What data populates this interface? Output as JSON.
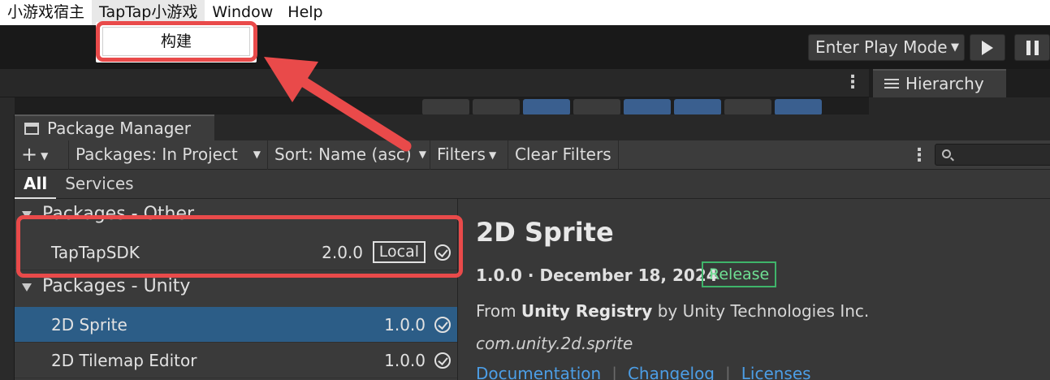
{
  "menubar": {
    "items": [
      "小游戏宿主",
      "TapTap小游戏",
      "Window",
      "Help"
    ]
  },
  "dropdown": {
    "item": "构建"
  },
  "toolbar": {
    "play_mode_label": "Enter Play Mode",
    "play_icon": "play-icon",
    "pause_icon": "pause-icon"
  },
  "hierarchy": {
    "tab_label": "Hierarchy"
  },
  "package_manager": {
    "tab_label": "Package Manager",
    "toolbar": {
      "add_label": "+",
      "packages_filter": "Packages: In Project",
      "sort": "Sort: Name (asc)",
      "filters": "Filters",
      "clear_filters": "Clear Filters"
    },
    "subtabs": [
      "All",
      "Services"
    ],
    "groups": [
      {
        "title": "Packages - Other",
        "packages": [
          {
            "name": "TapTapSDK",
            "version": "2.0.0",
            "badge": "Local"
          }
        ]
      },
      {
        "title": "Packages - Unity",
        "packages": [
          {
            "name": "2D Sprite",
            "version": "1.0.0"
          },
          {
            "name": "2D Tilemap Editor",
            "version": "1.0.0"
          }
        ]
      }
    ],
    "details": {
      "title": "2D Sprite",
      "version_date": "1.0.0 · December 18, 2024",
      "release_badge": "Release",
      "from_prefix": "From",
      "registry": "Unity Registry",
      "by_text": "by Unity Technologies Inc.",
      "package_id": "com.unity.2d.sprite",
      "links": [
        "Documentation",
        "Changelog",
        "Licenses"
      ]
    }
  },
  "colors": {
    "highlight": "#e94a4a",
    "selected_row": "#2c5d87",
    "release": "#3fb46a",
    "link": "#4c9ee6"
  }
}
